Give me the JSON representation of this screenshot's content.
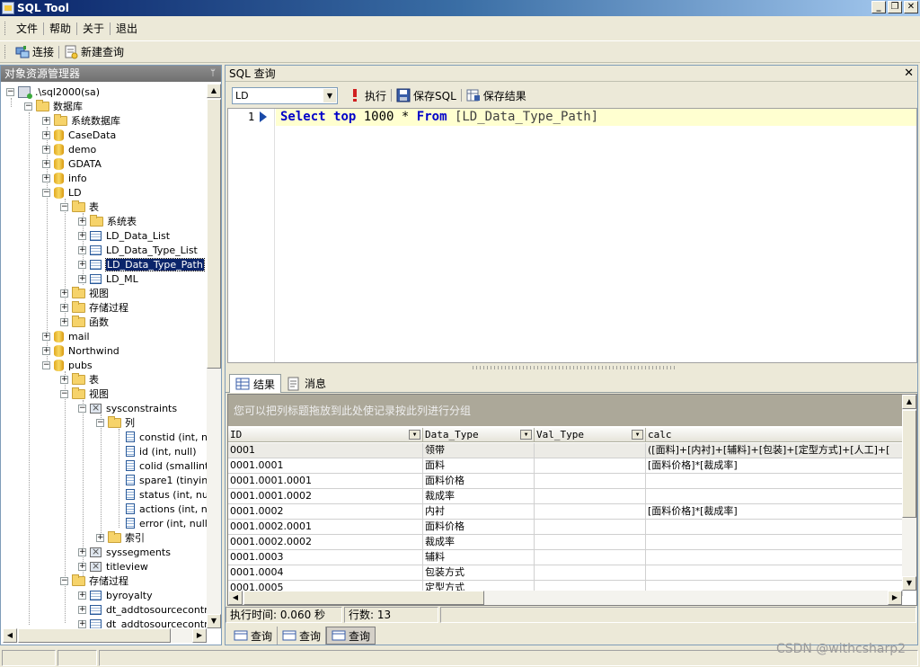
{
  "window": {
    "title": "SQL Tool"
  },
  "menu": [
    "文件",
    "帮助",
    "关于",
    "退出"
  ],
  "toolbar": {
    "connect": "连接",
    "new_query": "新建查询"
  },
  "explorer": {
    "title": "对象资源管理器",
    "nodes": [
      ".\\sql2000(sa)",
      "数据库",
      "系统数据库",
      "CaseData",
      "demo",
      "GDATA",
      "info",
      "LD",
      "表",
      "系统表",
      "LD_Data_List",
      "LD_Data_Type_List",
      "LD_Data_Type_Path",
      "LD_ML",
      "视图",
      "存储过程",
      "函数",
      "mail",
      "Northwind",
      "pubs",
      "表",
      "视图",
      "sysconstraints",
      "列",
      "constid (int, nu",
      "id (int, null)",
      "colid (smallint, r",
      "spare1 (tinyint,",
      "status (int, null",
      "actions (int, nu",
      "error (int, null)",
      "索引",
      "syssegments",
      "titleview",
      "存储过程",
      "byroyalty",
      "dt_addtosourcecontrol",
      "dt_addtosourcecontrol"
    ]
  },
  "query": {
    "panel_title": "SQL 查询",
    "database": "LD",
    "execute": "执行",
    "save_sql": "保存SQL",
    "save_result": "保存结果",
    "line_number": "1",
    "sql_tokens": [
      "Select",
      "top",
      "1000",
      "*",
      "From",
      "[LD_Data_Type_Path]"
    ]
  },
  "results": {
    "tab_results": "结果",
    "tab_messages": "消息",
    "group_hint": "您可以把列标题拖放到此处使记录按此列进行分组",
    "columns": [
      "ID",
      "Data_Type",
      "Val_Type",
      "calc"
    ],
    "rows": [
      [
        "0001",
        "领带",
        "",
        "([面料]+[内衬]+[辅料]+[包装]+[定型方式]+[人工]+["
      ],
      [
        "0001.0001",
        "面料",
        "",
        "[面料价格]*[裁成率]"
      ],
      [
        "0001.0001.0001",
        "面料价格",
        "",
        ""
      ],
      [
        "0001.0001.0002",
        "裁成率",
        "",
        ""
      ],
      [
        "0001.0002",
        "内衬",
        "",
        "[面料价格]*[裁成率]"
      ],
      [
        "0001.0002.0001",
        "面料价格",
        "",
        ""
      ],
      [
        "0001.0002.0002",
        "裁成率",
        "",
        ""
      ],
      [
        "0001.0003",
        "辅料",
        "",
        ""
      ],
      [
        "0001.0004",
        "包装方式",
        "",
        ""
      ],
      [
        "0001.0005",
        "定型方式",
        "",
        ""
      ]
    ]
  },
  "status": {
    "exec_time": "执行时间: 0.060 秒",
    "row_count": "行数: 13"
  },
  "doc_tabs": [
    "查询",
    "查询",
    "查询"
  ],
  "watermark": "CSDN @withcsharp2"
}
